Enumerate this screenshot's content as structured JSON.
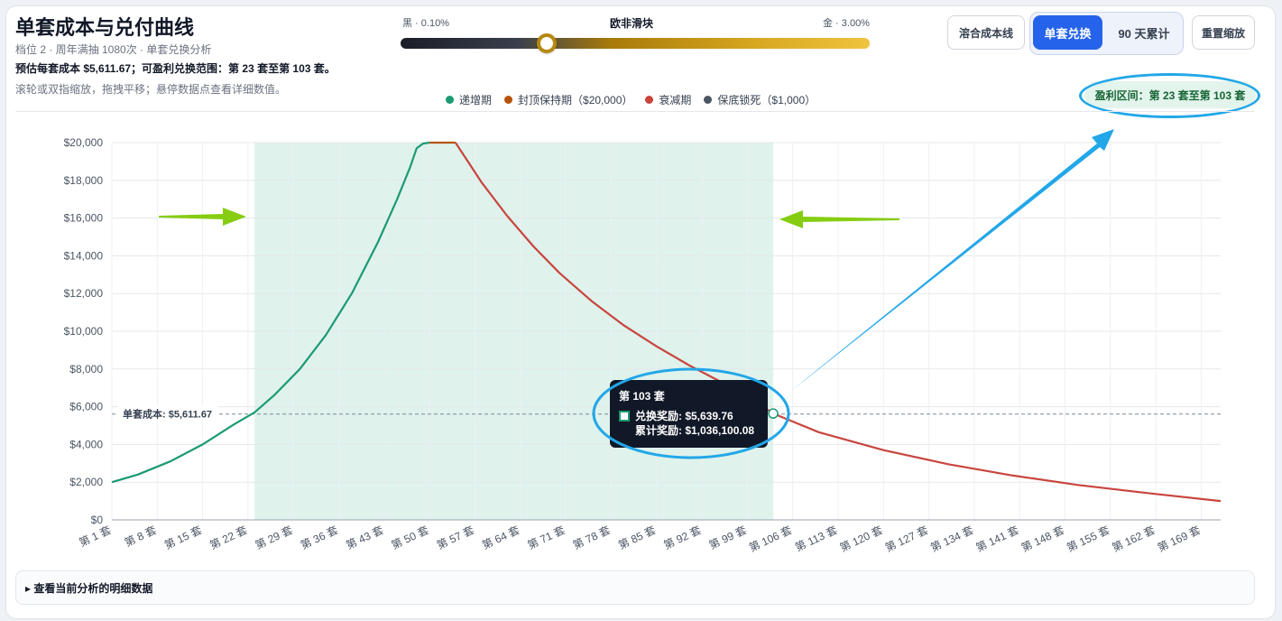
{
  "header": {
    "title": "单套成本与兑付曲线",
    "subtitle": "档位 2 · 周年满抽 1080次 · 单套兑换分析",
    "estimate": "预估每套成本 $5,611.67；可盈利兑换范围：第 23 套至第 103 套。",
    "hint": "滚轮或双指缩放，拖拽平移；悬停数据点查看详细数值。"
  },
  "slider": {
    "title": "欧非滑块",
    "left_label": "黑 · 0.10%",
    "right_label": "金 · 3.00%",
    "position": 0.3
  },
  "buttons": {
    "cost_line": "溶合成本线",
    "single": "单套兑换",
    "cumulative": "90 天累计",
    "reset_zoom": "重置缩放"
  },
  "profit_badge": "盈利区间：第 23 套至第 103 套",
  "details_label": "▸ 查看当前分析的明细数据",
  "legend": [
    {
      "label": "递增期",
      "color": "#1b9a73"
    },
    {
      "label": "封顶保持期（$20,000）",
      "color": "#b4540a"
    },
    {
      "label": "衰减期",
      "color": "#c8453e"
    },
    {
      "label": "保底锁死（$1,000）",
      "color": "#4b5563"
    }
  ],
  "tooltip": {
    "title": "第 103 套",
    "line1": "兑换奖励: $5,639.76",
    "line2": "累计奖励: $1,036,100.08"
  },
  "chart_data": {
    "type": "line",
    "y_ticks": [
      "$0",
      "$2,000",
      "$4,000",
      "$6,000",
      "$8,000",
      "$10,000",
      "$12,000",
      "$14,000",
      "$16,000",
      "$18,000",
      "$20,000"
    ],
    "x_ticks": [
      "第 1 套",
      "第 8 套",
      "第 15 套",
      "第 22 套",
      "第 29 套",
      "第 36 套",
      "第 43 套",
      "第 50 套",
      "第 57 套",
      "第 64 套",
      "第 71 套",
      "第 78 套",
      "第 85 套",
      "第 92 套",
      "第 99 套",
      "第 106 套",
      "第 113 套",
      "第 120 套",
      "第 127 套",
      "第 134 套",
      "第 141 套",
      "第 148 套",
      "第 155 套",
      "第 162 套",
      "第 169 套"
    ],
    "ylim": [
      0,
      20000
    ],
    "xlim": [
      1,
      172
    ],
    "cost_line": {
      "value": 5611.67,
      "label": "单套成本: $5,611.67"
    },
    "profit_range": [
      23,
      103
    ],
    "highlight_point": {
      "x": 103,
      "y": 5639.76
    },
    "series": [
      {
        "name": "递增期",
        "color": "#1b9a73",
        "x": [
          1,
          5,
          10,
          15,
          20,
          23,
          26,
          30,
          34,
          38,
          42,
          45,
          47,
          48,
          49,
          50
        ],
        "y": [
          2000,
          2400,
          3100,
          4000,
          5100,
          5700,
          6600,
          8000,
          9800,
          12000,
          14700,
          17000,
          18700,
          19700,
          19950,
          20000
        ]
      },
      {
        "name": "封顶保持期（$20,000）",
        "color": "#b4540a",
        "x": [
          50,
          51,
          52,
          53,
          54
        ],
        "y": [
          20000,
          20000,
          20000,
          20000,
          20000
        ]
      },
      {
        "name": "衰减期",
        "color": "#c8453e",
        "x": [
          54,
          58,
          62,
          66,
          70,
          75,
          80,
          85,
          90,
          95,
          100,
          103,
          110,
          120,
          130,
          140,
          150,
          160,
          172
        ],
        "y": [
          20000,
          17900,
          16100,
          14500,
          13100,
          11600,
          10300,
          9200,
          8200,
          7300,
          6300,
          5640,
          4650,
          3700,
          2950,
          2350,
          1850,
          1450,
          1000
        ]
      }
    ]
  }
}
